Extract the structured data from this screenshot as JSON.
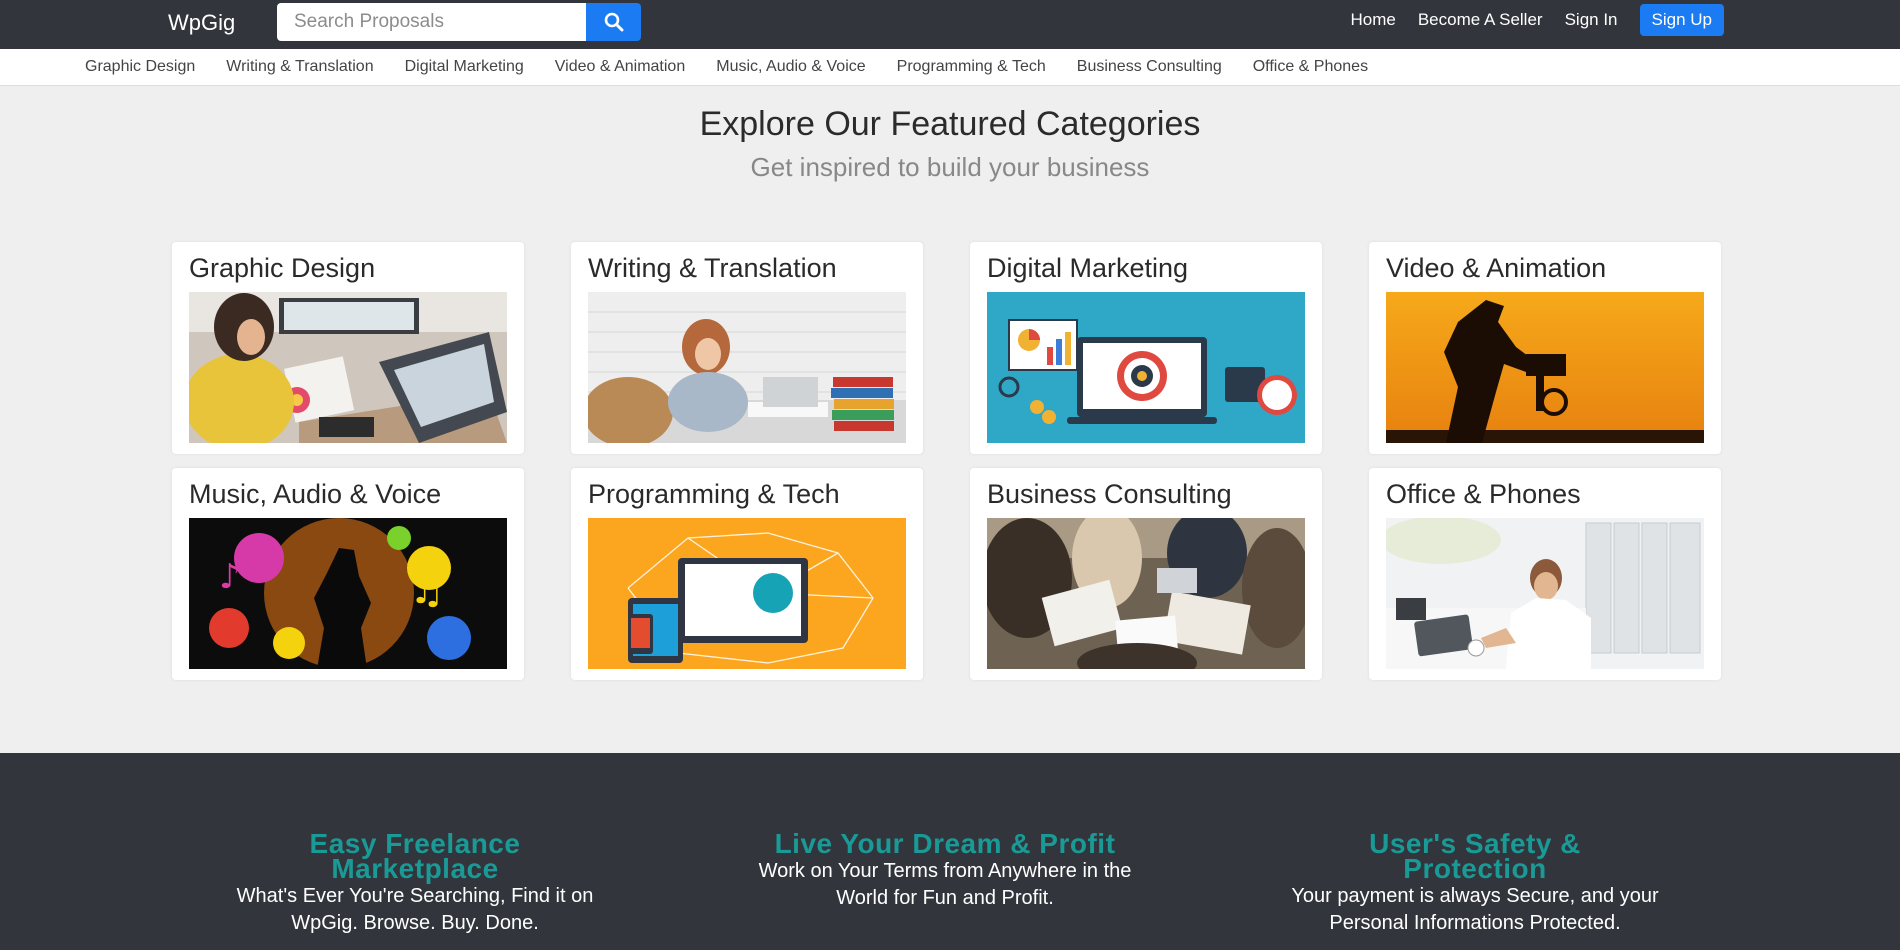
{
  "header": {
    "brand": "WpGig",
    "search_placeholder": "Search Proposals",
    "nav": [
      "Home",
      "Become A Seller",
      "Sign In"
    ],
    "signup_label": "Sign Up",
    "accent_color": "#1a7bf2"
  },
  "category_bar": [
    "Graphic Design",
    "Writing & Translation",
    "Digital Marketing",
    "Video & Animation",
    "Music, Audio & Voice",
    "Programming & Tech",
    "Business Consulting",
    "Office & Phones"
  ],
  "main": {
    "title": "Explore Our Featured Categories",
    "subtitle": "Get inspired to build your business"
  },
  "cards": [
    {
      "title": "Graphic Design"
    },
    {
      "title": "Writing & Translation"
    },
    {
      "title": "Digital Marketing"
    },
    {
      "title": "Video & Animation"
    },
    {
      "title": "Music, Audio & Voice"
    },
    {
      "title": "Programming & Tech"
    },
    {
      "title": "Business Consulting"
    },
    {
      "title": "Office & Phones"
    }
  ],
  "footer": {
    "features": [
      {
        "title_line1": "Easy Freelance",
        "title_line2": "Marketplace",
        "desc_line1": "What's Ever You're Searching, Find it on",
        "desc_line2": "WpGig. Browse. Buy. Done."
      },
      {
        "title_line1": "Live Your Dream & Profit",
        "title_line2": "",
        "desc_line1": "Work on Your Terms from Anywhere in the",
        "desc_line2": "World for Fun and Profit."
      },
      {
        "title_line1": "User's Safety &",
        "title_line2": "Protection",
        "desc_line1": "Your payment is always Secure, and your",
        "desc_line2": "Personal Informations Protected."
      }
    ],
    "title_color": "#1a9a96"
  }
}
